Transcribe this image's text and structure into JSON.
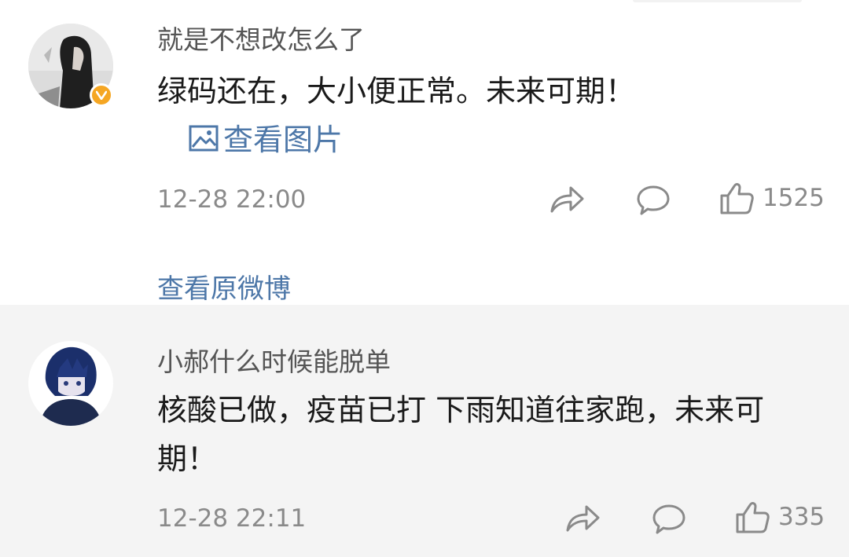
{
  "comments": [
    {
      "username": "就是不想改怎么了",
      "text": "绿码还在，大小便正常。未来可期！",
      "image_link": "查看图片",
      "time": "12-28 22:00",
      "likes": "1525",
      "verified": true
    },
    {
      "username": "小郝什么时候能脱单",
      "text": "核酸已做，疫苗已打 下雨知道往家跑，未来可期！",
      "time": "12-28 22:11",
      "likes": "335",
      "verified": false
    }
  ],
  "view_original": "查看原微博",
  "icons": {
    "repost": "share-arrow-icon",
    "comment": "comment-bubble-icon",
    "like": "thumbs-up-icon",
    "image": "image-icon",
    "verified": "verified-badge-icon"
  },
  "colors": {
    "link": "#4d77a8",
    "meta": "#8a8a8a",
    "badge": "#f5a623",
    "second_bg": "#f4f4f4"
  }
}
